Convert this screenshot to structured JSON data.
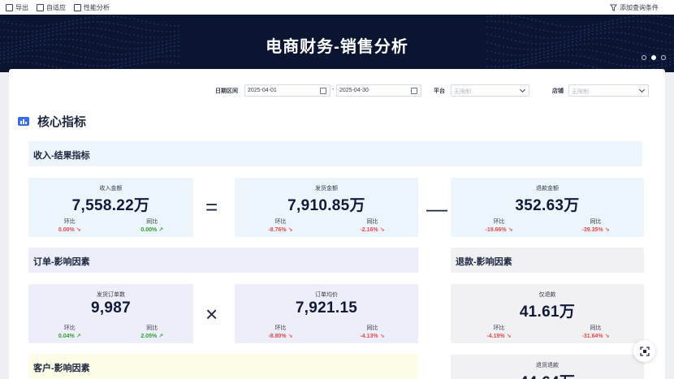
{
  "toolbar": {
    "export_label": "导出",
    "adapt_label": "自适应",
    "perf_label": "性能分析",
    "add_filter_label": "添加查询条件"
  },
  "banner": {
    "title": "电商财务-销售分析",
    "carousel_pages": 3,
    "active_page": 2
  },
  "filters": {
    "date_label": "日期区间",
    "date_start": "2025-04-01",
    "date_sep": "-",
    "date_end": "2025-04-30",
    "platform_label": "平台",
    "platform_placeholder": "无限制",
    "store_label": "店铺",
    "store_placeholder": "无限制"
  },
  "section": {
    "title": "核心指标"
  },
  "groups": {
    "income": "收入-结果指标",
    "order": "订单-影响因素",
    "refund": "退款-影响因素",
    "customer": "客户-影响因素"
  },
  "operators": {
    "equals": "=",
    "minus": "—",
    "times": "×"
  },
  "cards": {
    "income": {
      "label": "收入金额",
      "value": "7,558.22万",
      "mom_label": "环比",
      "mom": "0.00%",
      "yoy_label": "同比",
      "yoy": "0.00%"
    },
    "shipped": {
      "label": "发货金额",
      "value": "7,910.85万",
      "mom_label": "环比",
      "mom": "-8.76%",
      "yoy_label": "同比",
      "yoy": "-2.16%"
    },
    "refund": {
      "label": "退款金额",
      "value": "352.63万",
      "mom_label": "环比",
      "mom": "-19.66%",
      "yoy_label": "同比",
      "yoy": "-39.35%"
    },
    "orders": {
      "label": "发货订单数",
      "value": "9,987",
      "mom_label": "环比",
      "mom": "0.04%",
      "yoy_label": "同比",
      "yoy": "2.05%"
    },
    "avg_price": {
      "label": "订单均价",
      "value": "7,921.15",
      "mom_label": "环比",
      "mom": "-8.80%",
      "yoy_label": "同比",
      "yoy": "-4.13%"
    },
    "refund_only": {
      "label": "仅退款",
      "value": "41.61万",
      "mom_label": "环比",
      "mom": "-4.19%",
      "yoy_label": "同比",
      "yoy": "-31.64%"
    },
    "return_refund": {
      "label": "退货退款",
      "value": "44.64万"
    }
  },
  "colors": {
    "banner_bg": "#0b1431",
    "accent_blue": "#3b6de8",
    "positive": "#2ca12c",
    "negative": "#e84b4b",
    "card_blue": "#ecf4fc",
    "card_purple": "#eeeefa",
    "card_grey": "#f1f1f3",
    "card_yellow": "#fdfce6"
  },
  "icons": [
    "export-icon",
    "adapt-icon",
    "perf-icon",
    "filter-icon",
    "calendar-icon",
    "chevron-down-icon",
    "chart-icon",
    "trend-down-icon",
    "trend-up-icon",
    "scan-icon"
  ]
}
